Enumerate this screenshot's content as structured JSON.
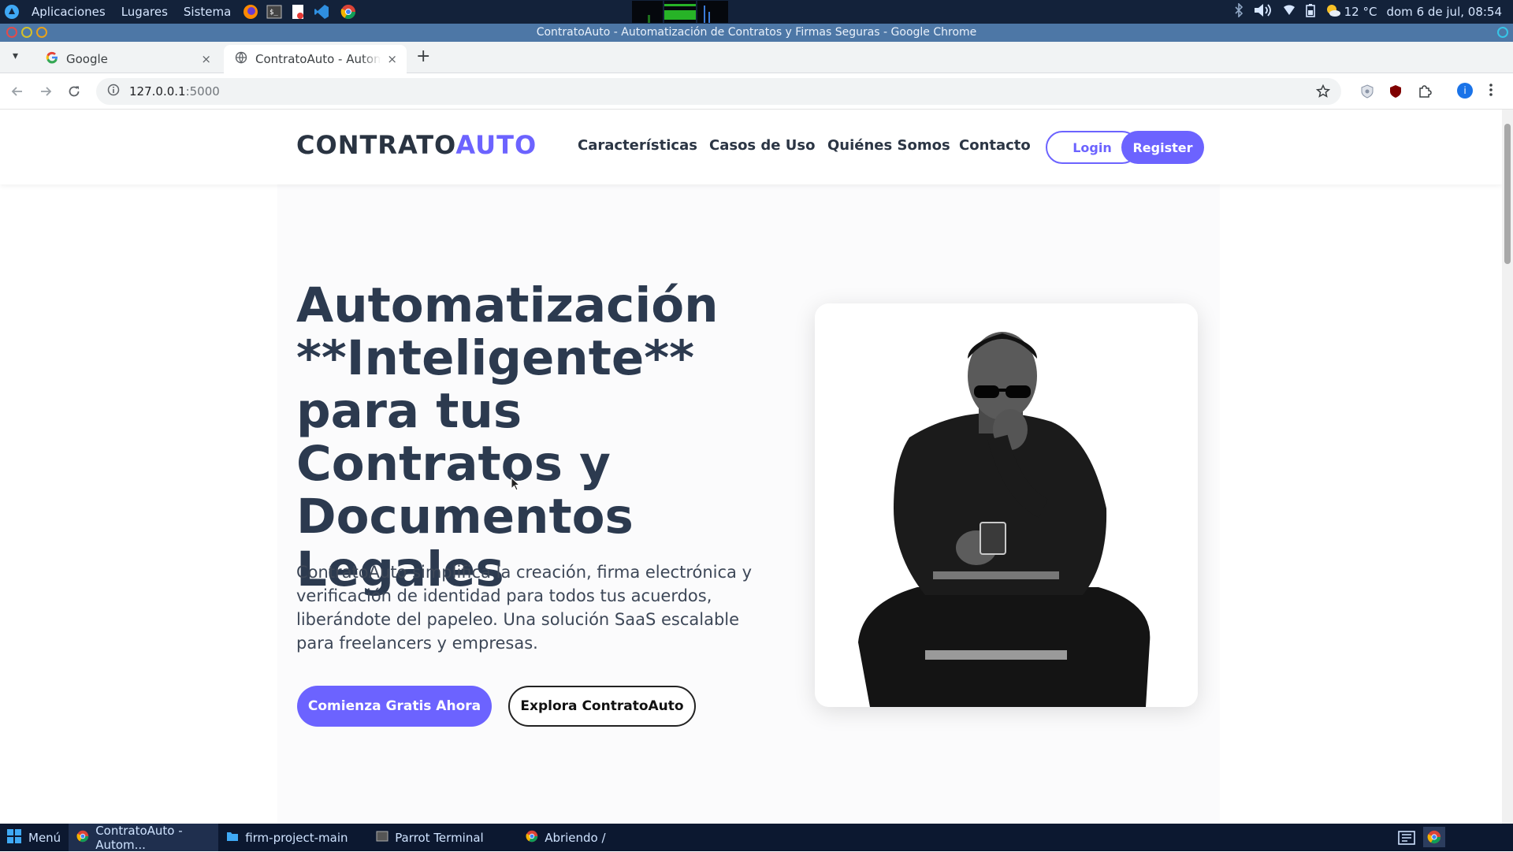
{
  "system_panel": {
    "menu": [
      "Aplicaciones",
      "Lugares",
      "Sistema"
    ],
    "weather": "12 °C",
    "datetime": "dom 6 de jul, 08:54"
  },
  "window": {
    "title": "ContratoAuto - Automatización de Contratos y Firmas Seguras - Google Chrome"
  },
  "tabs": [
    {
      "title": "Google",
      "close": "×"
    },
    {
      "title": "ContratoAuto - Automatiz",
      "close": "×"
    }
  ],
  "new_tab": "+",
  "address_bar": {
    "host": "127.0.0.1",
    "port": ":5000"
  },
  "site": {
    "logo_main": "CONTRATO",
    "logo_accent": "AUTO",
    "nav": [
      "Características",
      "Casos de Uso",
      "Quiénes Somos",
      "Contacto"
    ],
    "login_label": "Login",
    "register_label": "Register",
    "accent_color": "#6c63ff"
  },
  "hero": {
    "title": "Automatización **Inteligente** para tus Contratos y Documentos Legales",
    "subtitle": "ContratoAuto simplifica la creación, firma electrónica y verificación de identidad para todos tus acuerdos, liberándote del papeleo. Una solución SaaS escalable para freelancers y empresas.",
    "cta_primary": "Comienza Gratis Ahora",
    "cta_secondary": "Explora ContratoAuto"
  },
  "taskbar": {
    "menu_label": "Menú",
    "items": [
      "ContratoAuto - Autom...",
      "firm-project-main",
      "Parrot Terminal",
      "Abriendo /"
    ]
  }
}
